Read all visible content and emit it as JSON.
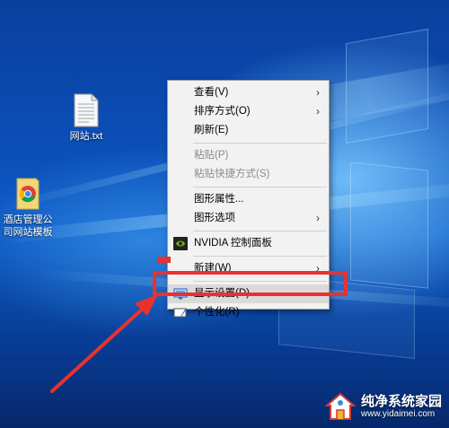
{
  "desktop": {
    "icons": [
      {
        "label": "网站.txt",
        "icon": "text-file-icon"
      },
      {
        "label": "酒店管理公\n司网站模板",
        "icon": "chrome-folder-icon"
      }
    ]
  },
  "context_menu": {
    "items": [
      {
        "label": "查看(V)",
        "submenu": true,
        "enabled": true
      },
      {
        "label": "排序方式(O)",
        "submenu": true,
        "enabled": true
      },
      {
        "label": "刷新(E)",
        "submenu": false,
        "enabled": true
      },
      {
        "label": "粘贴(P)",
        "submenu": false,
        "enabled": false
      },
      {
        "label": "粘贴快捷方式(S)",
        "submenu": false,
        "enabled": false
      },
      {
        "label": "图形属性...",
        "submenu": false,
        "enabled": true
      },
      {
        "label": "图形选项",
        "submenu": true,
        "enabled": true
      },
      {
        "label": "NVIDIA 控制面板",
        "submenu": false,
        "enabled": true,
        "icon": "nvidia-icon"
      },
      {
        "label": "新建(W)",
        "submenu": true,
        "enabled": true
      },
      {
        "label": "显示设置(D)",
        "submenu": false,
        "enabled": true,
        "icon": "display-icon",
        "highlighted": true
      },
      {
        "label": "个性化(R)",
        "submenu": false,
        "enabled": true,
        "icon": "personalize-icon"
      }
    ],
    "arrow_glyph": "›"
  },
  "watermark": {
    "title": "纯净系统家园",
    "url": "www.yidaimei.com"
  },
  "colors": {
    "annotation_red": "#e8322f",
    "menu_bg": "#f2f2f2"
  }
}
